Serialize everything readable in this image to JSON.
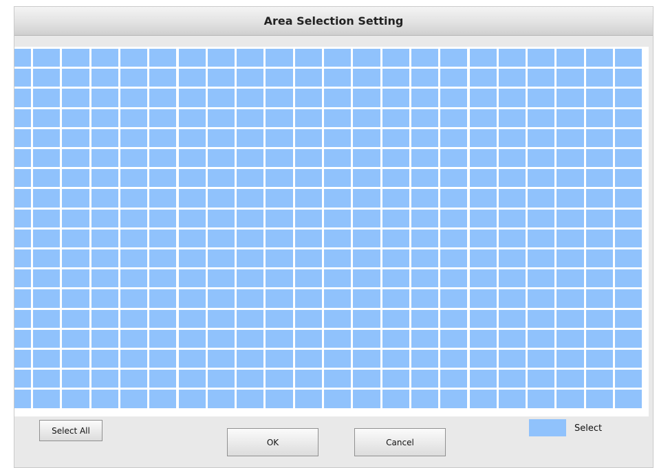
{
  "dialog": {
    "title": "Area Selection Setting"
  },
  "grid": {
    "rows": 18,
    "cols": 22,
    "selected_color": "#90c2fc",
    "all_selected": true
  },
  "buttons": {
    "select_all": "Select All",
    "ok": "OK",
    "cancel": "Cancel"
  },
  "legend": {
    "label": "Select",
    "color": "#90c2fc"
  }
}
